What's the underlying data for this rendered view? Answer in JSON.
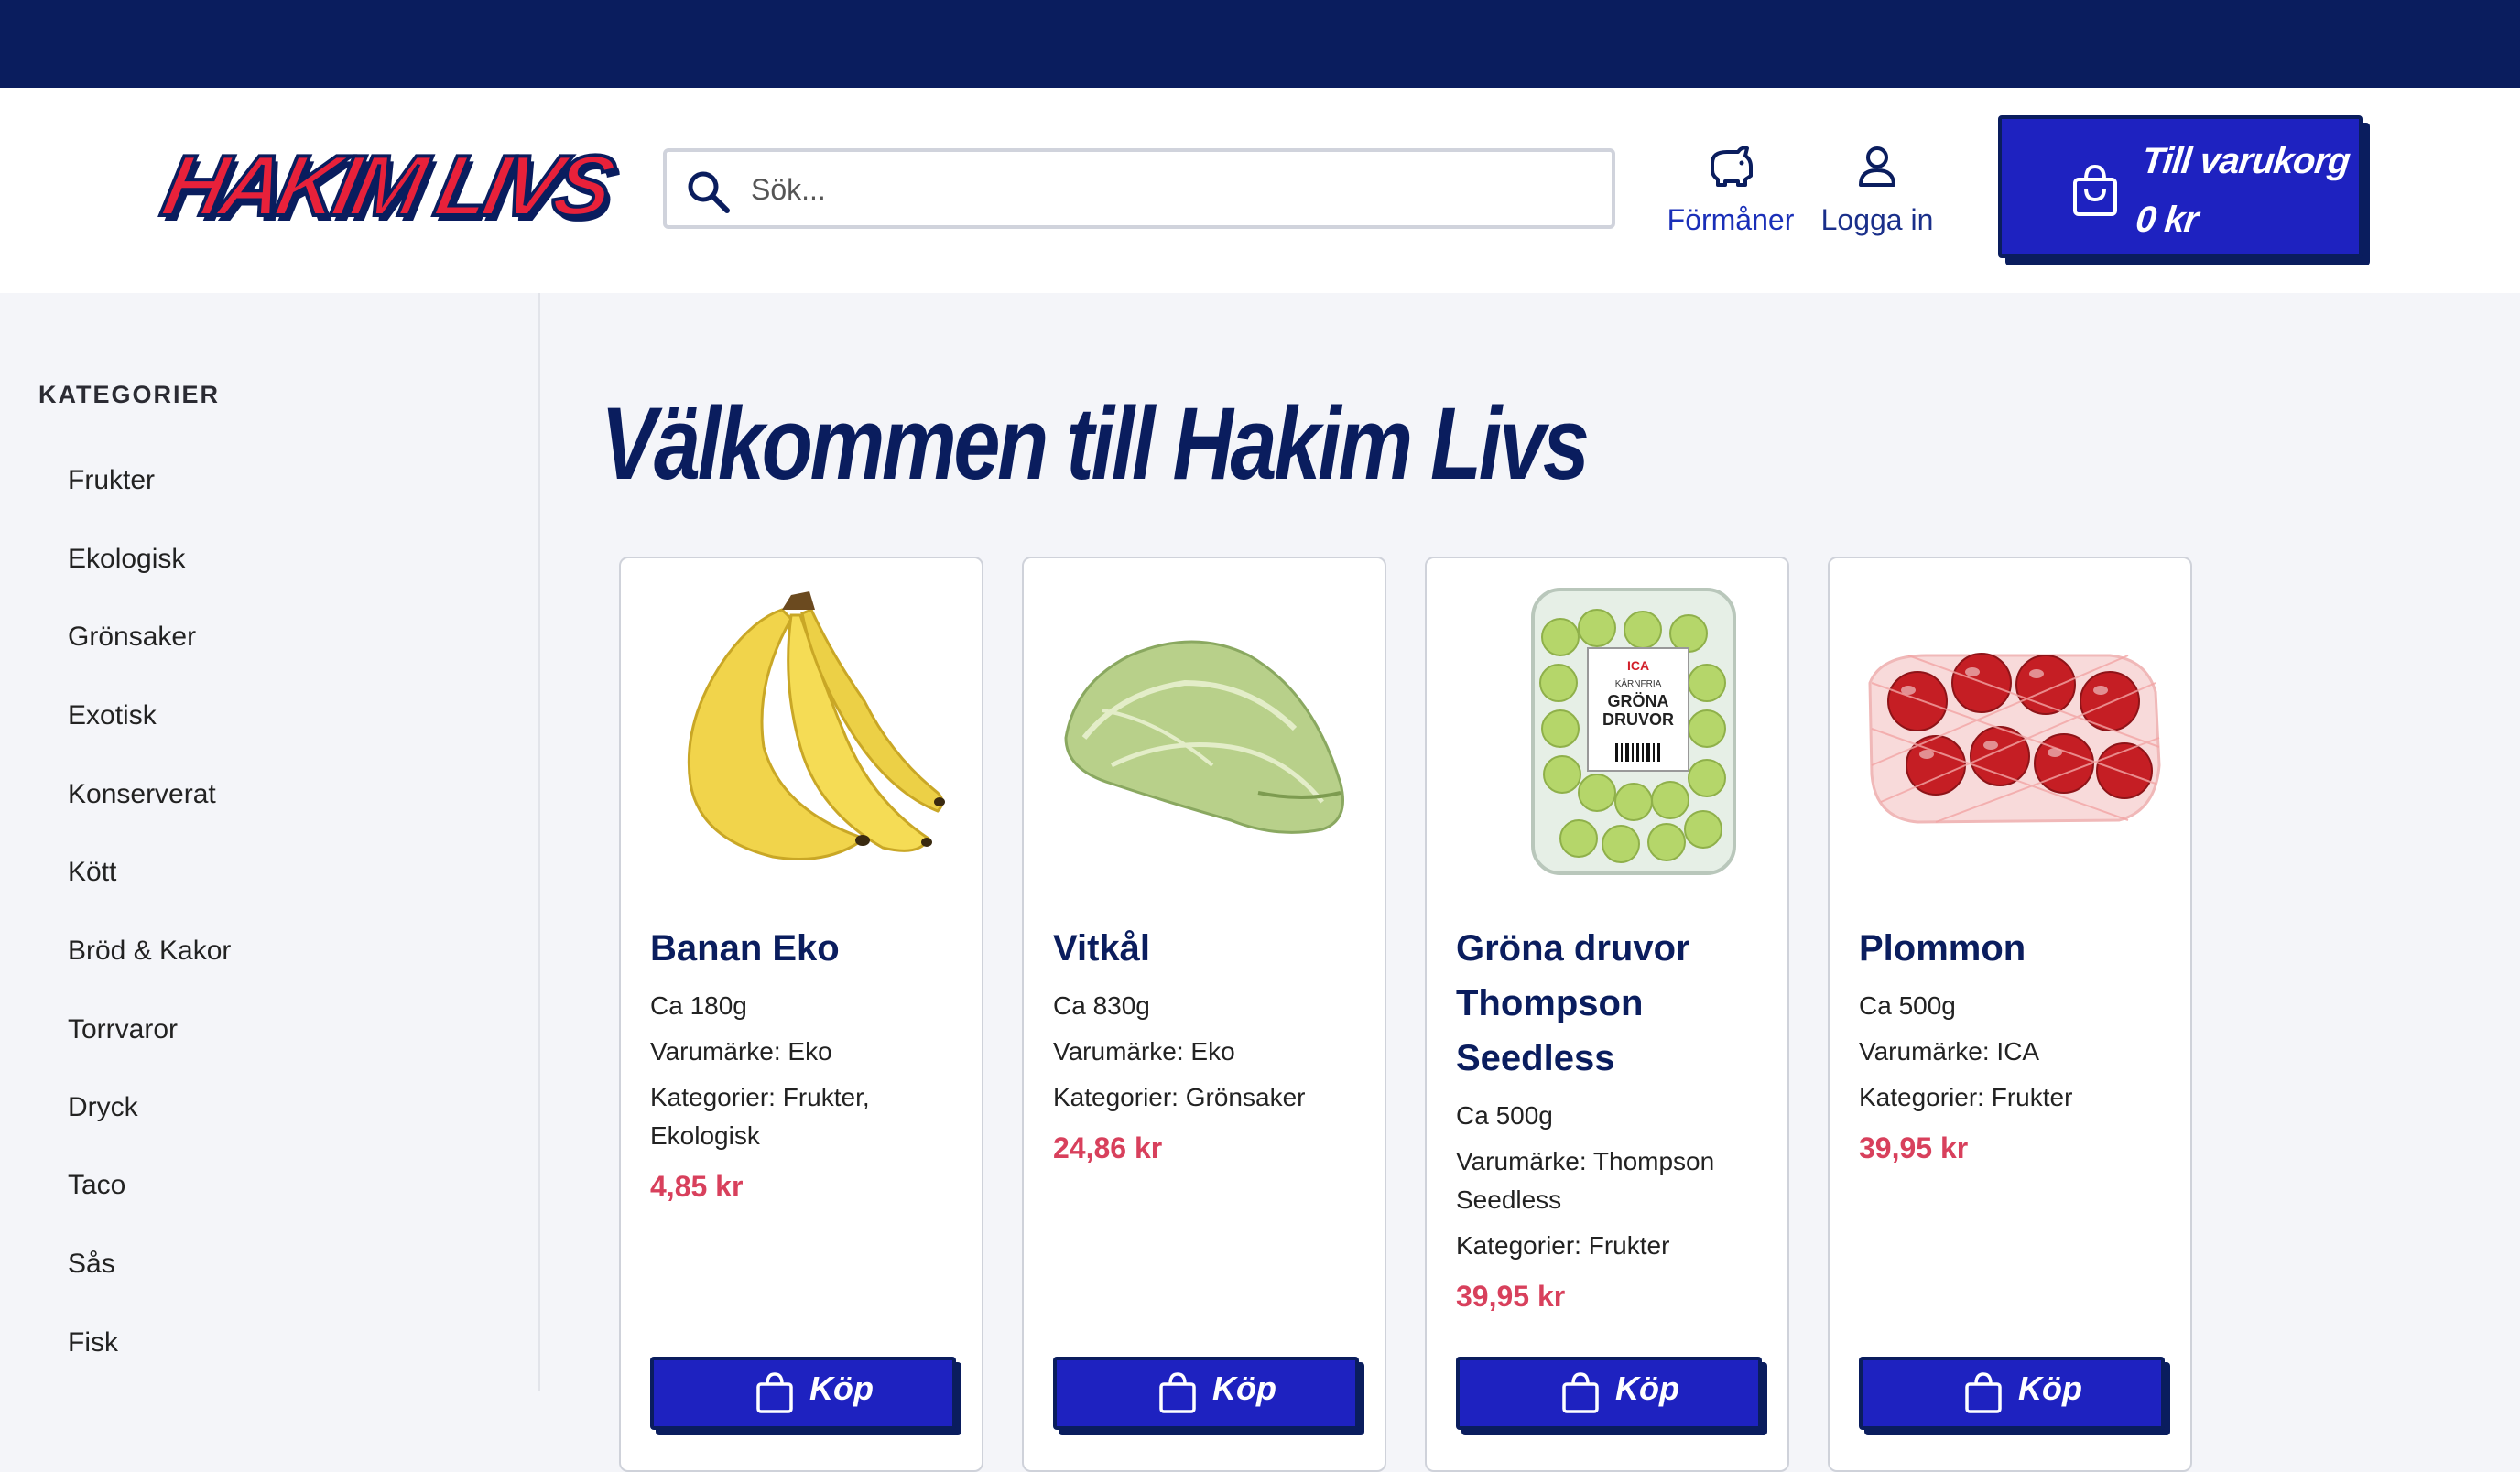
{
  "header": {
    "logo_text": "HAKIM LIVS",
    "search_placeholder": "Sök...",
    "benefits_label": "Förmåner",
    "login_label": "Logga in",
    "cart_label": "Till varukorg",
    "cart_total": "0 kr"
  },
  "sidebar": {
    "title": "KATEGORIER",
    "items": [
      {
        "label": "Frukter"
      },
      {
        "label": "Ekologisk"
      },
      {
        "label": "Grönsaker"
      },
      {
        "label": "Exotisk"
      },
      {
        "label": "Konserverat"
      },
      {
        "label": "Kött"
      },
      {
        "label": "Bröd & Kakor"
      },
      {
        "label": "Torrvaror"
      },
      {
        "label": "Dryck"
      },
      {
        "label": "Taco"
      },
      {
        "label": "Sås"
      },
      {
        "label": "Fisk"
      }
    ]
  },
  "main": {
    "title": "Välkommen till Hakim Livs",
    "products": [
      {
        "name": "Banan Eko",
        "weight": "Ca 180g",
        "brand": "Varumärke: Eko",
        "categories": "Kategorier: Frukter, Ekologisk",
        "price": "4,85 kr",
        "buy_label": "Köp",
        "image": "banana-image"
      },
      {
        "name": "Vitkål",
        "weight": "Ca 830g",
        "brand": "Varumärke: Eko",
        "categories": "Kategorier: Grönsaker",
        "price": "24,86 kr",
        "buy_label": "Köp",
        "image": "cabbage-image"
      },
      {
        "name": "Gröna druvor Thompson Seedless",
        "weight": "Ca 500g",
        "brand": "Varumärke: Thompson Seedless",
        "categories": "Kategorier: Frukter",
        "price": "39,95 kr",
        "buy_label": "Köp",
        "image": "grapes-image",
        "package_text": {
          "brand": "ICA",
          "sub": "KÄRNFRIA",
          "line1": "GRÖNA",
          "line2": "DRUVOR"
        }
      },
      {
        "name": "Plommon",
        "weight": "Ca 500g",
        "brand": "Varumärke: ICA",
        "categories": "Kategorier: Frukter",
        "price": "39,95 kr",
        "buy_label": "Köp",
        "image": "plums-image"
      }
    ]
  },
  "colors": {
    "navy": "#0a1d5e",
    "brand_red": "#e8213a",
    "button_blue": "#1e22c0",
    "price_red": "#d8405c"
  }
}
